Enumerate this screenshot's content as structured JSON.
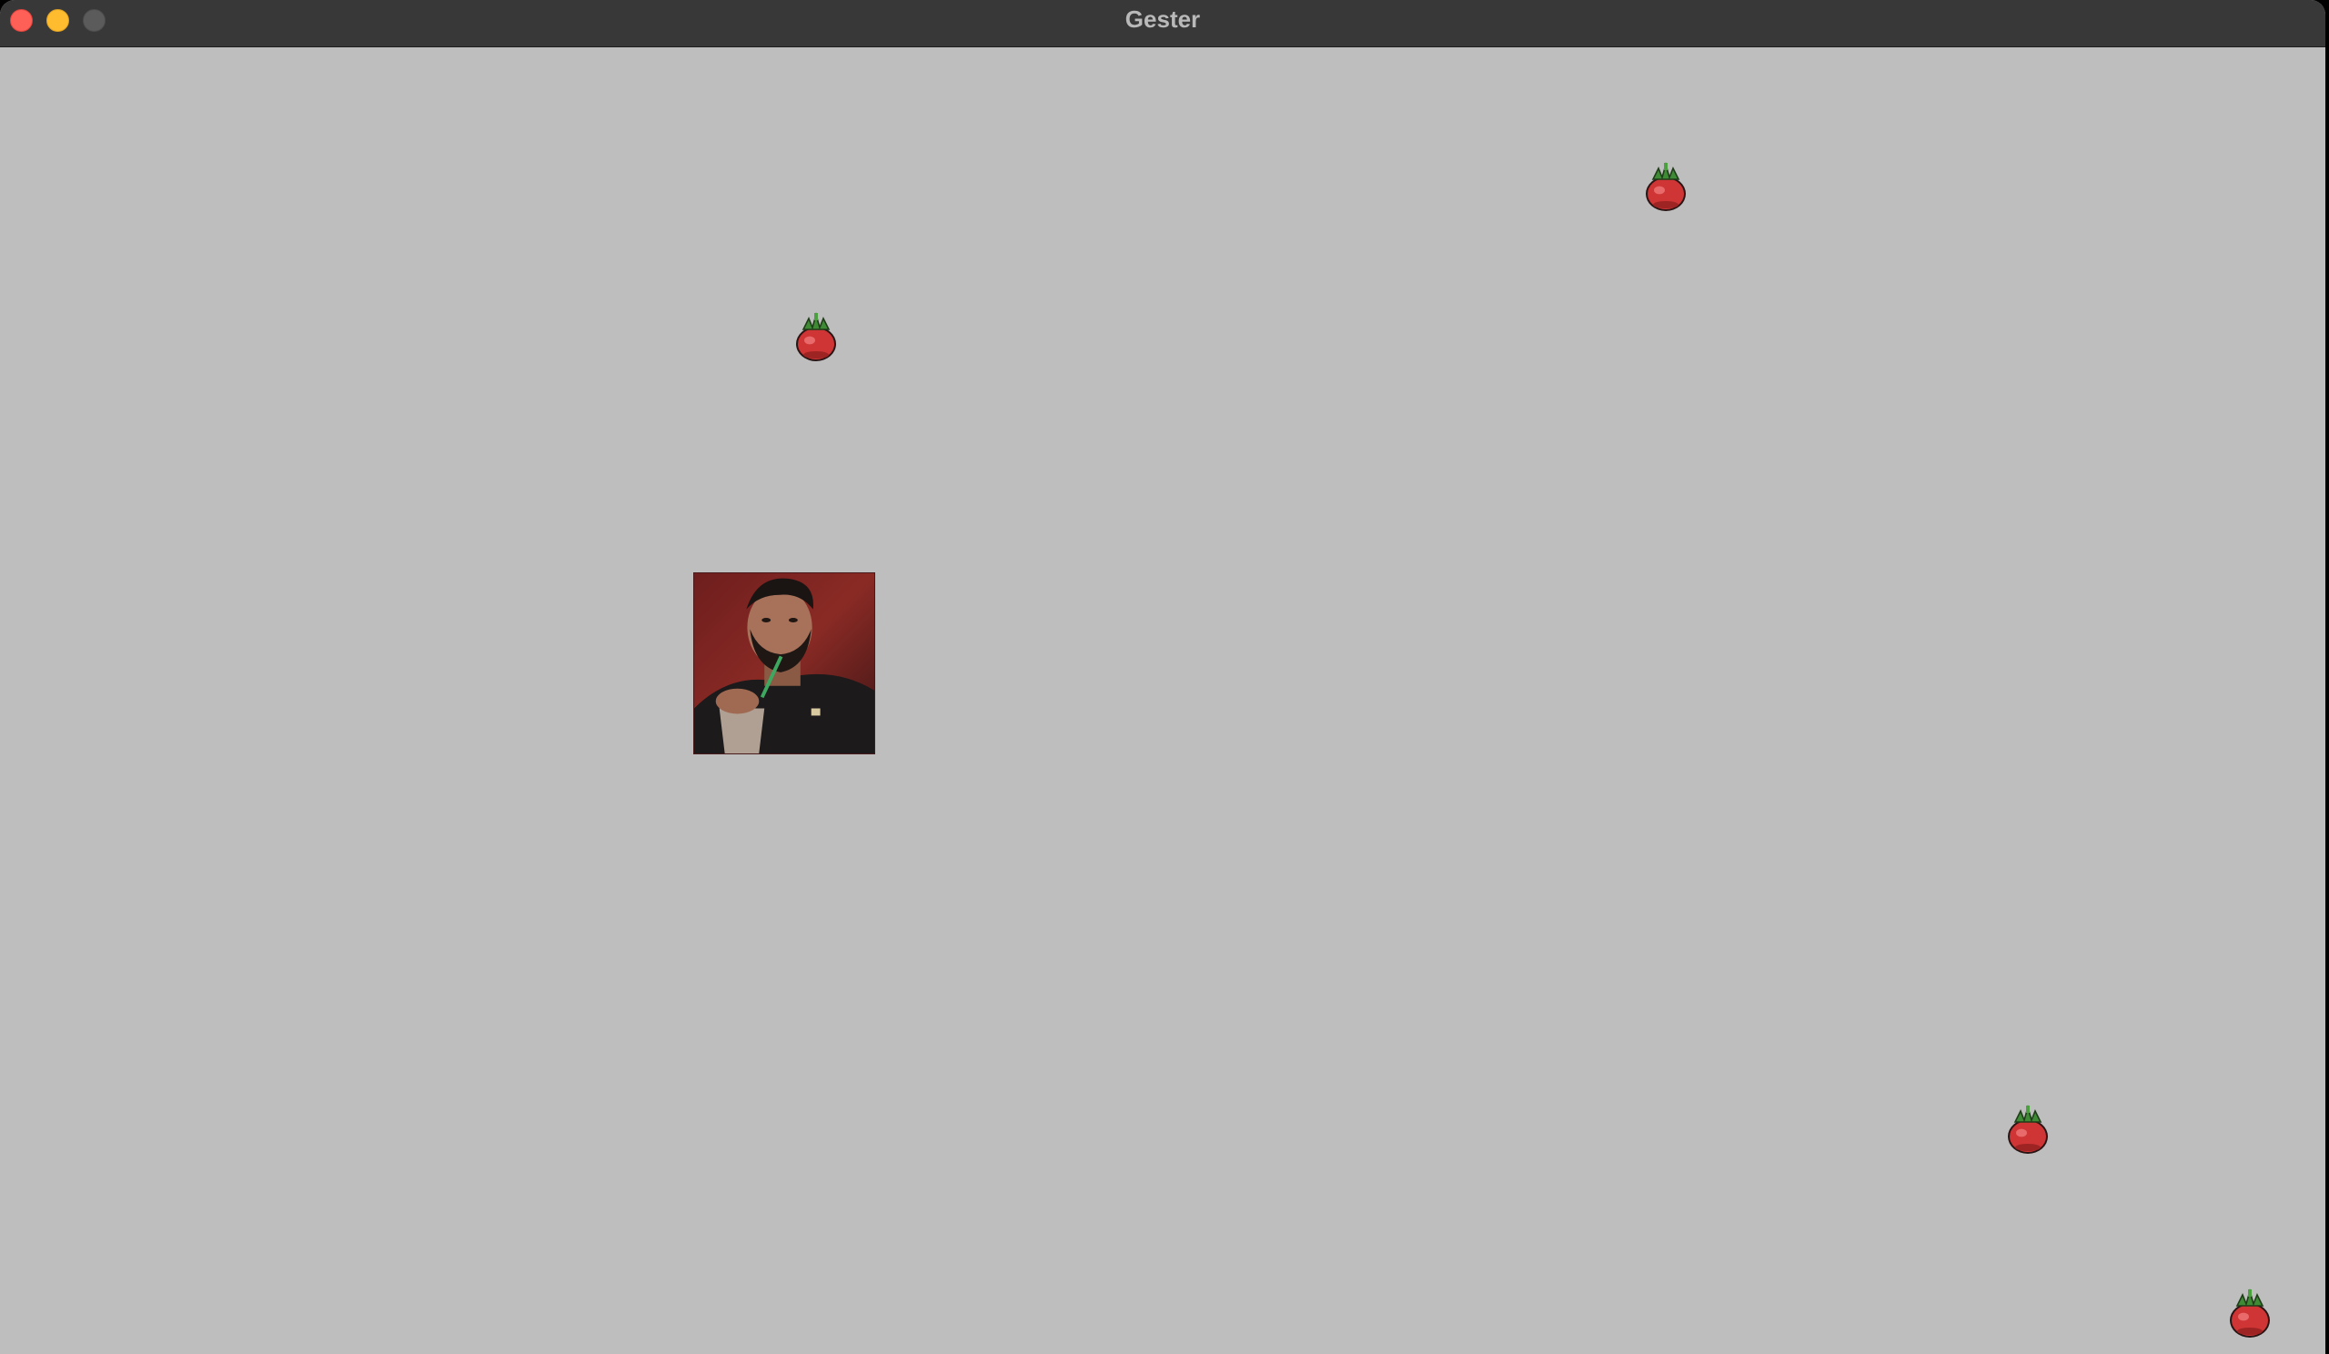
{
  "window": {
    "title": "Gester",
    "traffic_lights": {
      "close_color": "#fe5f57",
      "minimize_color": "#febc2e",
      "zoom_color": "#5b5b5b"
    }
  },
  "game": {
    "background_color": "#bebebe",
    "player": {
      "icon": "player-portrait"
    },
    "collectibles": [
      {
        "icon": "tomato-sprite"
      },
      {
        "icon": "tomato-sprite"
      },
      {
        "icon": "tomato-sprite"
      },
      {
        "icon": "tomato-sprite"
      }
    ]
  }
}
